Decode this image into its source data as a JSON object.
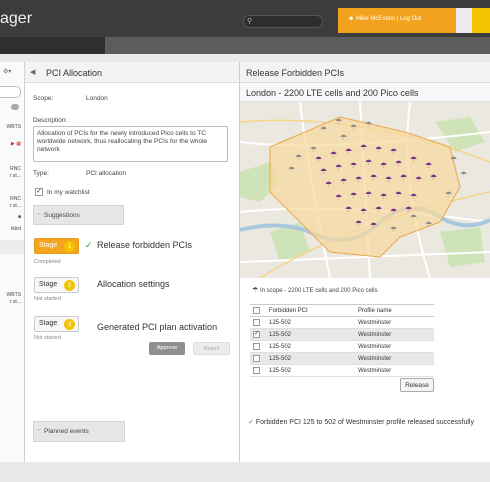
{
  "app": {
    "title": "ager"
  },
  "header": {
    "user_label": "Mike McEvans",
    "separator": "|",
    "logout_label": "Log Out",
    "search_placeholder": ""
  },
  "sidebar": {
    "fragments": [
      "WBTS",
      "RNC",
      "r st...",
      "RNC",
      "r st...",
      "rklist",
      "WBTS",
      "r st..."
    ]
  },
  "pci_allocation": {
    "title": "PCI Allocation",
    "scope_label": "Scope:",
    "scope_value": "London",
    "description_label": "Description:",
    "description_text": "Allocation of PCIs for the newly introduced Pico cells to TC worldwide network, thus reallocating the PCIs for the whole network",
    "type_label": "Type:",
    "type_value": "PCI allocation",
    "watchlist_label": "In my watchlist",
    "watchlist_checked": true,
    "suggestions_label": "Suggestions",
    "planned_events_label": "Planned events",
    "stages": [
      {
        "label": "Stage",
        "number": "1",
        "title": "Release forbidden PCIs",
        "status": "Completed",
        "active": true
      },
      {
        "label": "Stage",
        "number": "2",
        "title": "Allocation settings",
        "status": "Not started",
        "active": false
      },
      {
        "label": "Stage",
        "number": "3",
        "title": "Generated PCI plan activation",
        "status": "Not started",
        "active": false
      }
    ],
    "approve_label": "Approve",
    "reject_label": "Reject"
  },
  "release_panel": {
    "title": "Release Forbidden PCIs",
    "subtitle": "London - 2200 LTE cells and 200 Pico cells",
    "legend": "In scope - 2200 LTE cells and 200 Pico cells",
    "table": {
      "headers": [
        "",
        "Forbidden PCI",
        "Profile name"
      ],
      "rows": [
        {
          "checked": false,
          "pci": "125-502",
          "profile": "Westminster"
        },
        {
          "checked": true,
          "pci": "125-502",
          "profile": "Westminster"
        },
        {
          "checked": false,
          "pci": "125-502",
          "profile": "Westminster"
        },
        {
          "checked": false,
          "pci": "125-502",
          "profile": "Westminster"
        },
        {
          "checked": false,
          "pci": "125-502",
          "profile": "Westminster"
        }
      ]
    },
    "release_button": "Release",
    "success_message": "Forbidden PCI 125 to 502 of Westminster profile released successfully"
  },
  "colors": {
    "accent": "#f5a41d",
    "highlight": "#f5c400",
    "cell_purple": "#7a2c8a",
    "cell_gray": "#8a8a8a",
    "success": "#3a9c3a"
  },
  "icons": [
    "search-icon",
    "user-icon",
    "gear-icon",
    "chevron-left-icon",
    "check-icon",
    "cell-tower-icon"
  ]
}
